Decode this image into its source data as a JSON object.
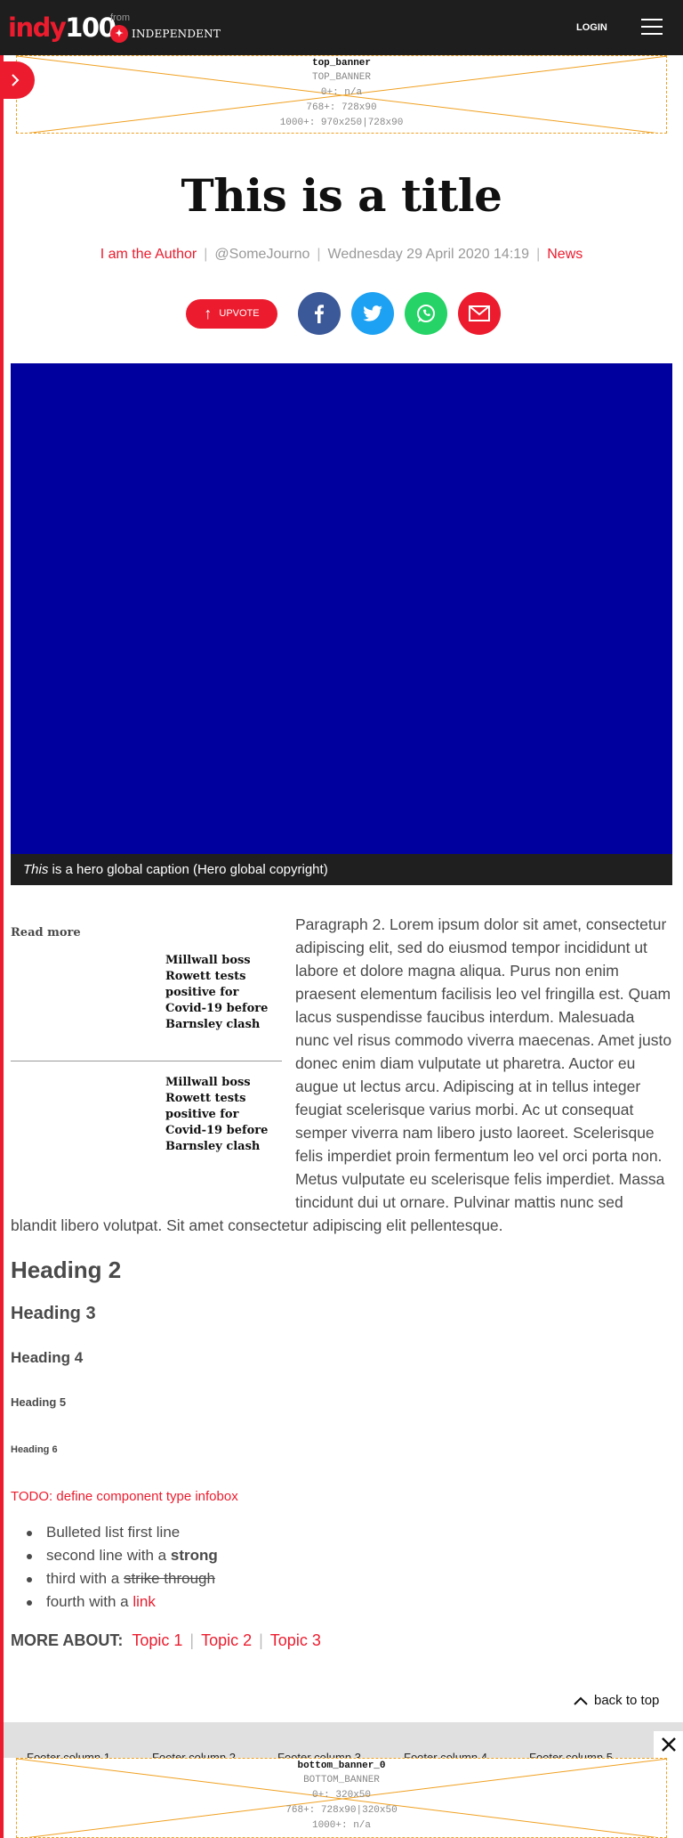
{
  "header": {
    "logo_indy": "indy",
    "logo_num": "100",
    "from_label": "from",
    "independent": "INDEPENDENT",
    "login": "LOGIN"
  },
  "ads": {
    "top": {
      "title": "top_banner",
      "lines": [
        "TOP_BANNER",
        "0+: n/a",
        "768+: 728x90",
        "1000+: 970x250|728x90"
      ]
    },
    "bottom": {
      "title": "bottom_banner_0",
      "lines": [
        "BOTTOM_BANNER",
        "0+: 320x50",
        "768+: 728x90|320x50",
        "1000+: n/a"
      ]
    }
  },
  "article": {
    "title": "This is a title",
    "author": "I am the Author",
    "handle": "@SomeJourno",
    "date": "Wednesday 29 April 2020 14:19",
    "section": "News",
    "upvote": "UPVOTE",
    "hero_caption_em": "This",
    "hero_caption_rest": " is a hero global caption (Hero global copyright)",
    "paragraph": "Paragraph 2. Lorem ipsum dolor sit amet, consectetur adipiscing elit, sed do eiusmod tempor incididunt ut labore et dolore magna aliqua. Purus non enim praesent elementum facilisis leo vel fringilla est. Quam lacus suspendisse faucibus interdum. Malesuada nunc vel risus commodo viverra maecenas. Amet justo donec enim diam vulputate ut pharetra. Auctor eu augue ut lectus arcu. Adipiscing at in tellus integer feugiat scelerisque varius morbi. Ac ut consequat semper viverra nam libero justo laoreet. Scelerisque felis imperdiet proin fermentum leo vel orci porta non. Metus vulputate eu scelerisque felis imperdiet. Massa tincidunt dui ut ornare. Pulvinar mattis nunc sed",
    "paragraph_tail": "blandit libero volutpat. Sit amet consectetur adipiscing elit pellentesque.",
    "h2": "Heading 2",
    "h3": "Heading 3",
    "h4": "Heading 4",
    "h5": "Heading 5",
    "h6": "Heading 6",
    "todo": "TODO: define component type infobox",
    "bullets": {
      "b1": "Bulleted list first line",
      "b2_pre": "second line with a ",
      "b2_strong": "strong",
      "b3_pre": "third with a ",
      "b3_strike": "strike through",
      "b4_pre": "fourth with a ",
      "b4_link": "link"
    },
    "more_about": {
      "label": "MORE ABOUT:",
      "topics": [
        "Topic 1",
        "Topic 2",
        "Topic 3"
      ]
    }
  },
  "read_more": {
    "title": "Read more",
    "items": [
      "Millwall boss Rowett tests positive for Covid-19 before Barnsley clash",
      "Millwall boss Rowett tests positive for Covid-19 before Barnsley clash"
    ]
  },
  "back_to_top": "back to top",
  "footer": {
    "columns": [
      "Footer column 1",
      "Footer column 2",
      "Footer column 3",
      "Footer column 4",
      "Footer column 5"
    ]
  },
  "colors": {
    "brand_red": "#ec1c2e",
    "header_bg": "#1e1e1e",
    "hero_blue": "#00009e",
    "facebook": "#3b5998",
    "twitter": "#1da1f2",
    "whatsapp": "#25d366"
  },
  "icons": [
    "chevron-right-icon",
    "hamburger-icon",
    "arrow-up-icon",
    "facebook-icon",
    "twitter-icon",
    "whatsapp-icon",
    "email-icon",
    "chevron-up-icon",
    "close-icon"
  ]
}
